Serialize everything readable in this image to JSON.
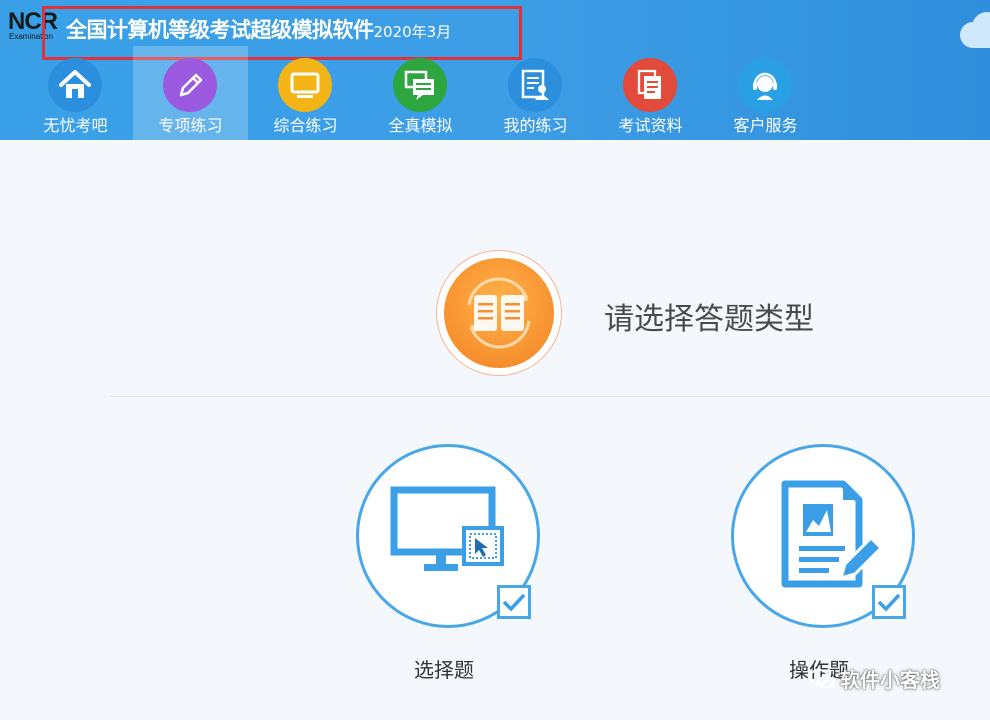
{
  "app": {
    "logo_text": "NCR",
    "logo_sub": "Examination",
    "title": "全国计算机等级考试超级模拟软件",
    "title_date": "2020年3月"
  },
  "nav": {
    "items": [
      {
        "label": "无忧考吧",
        "icon": "home-icon",
        "color": "#2b8fde"
      },
      {
        "label": "专项练习",
        "icon": "pencil-icon",
        "color": "#9b59e0",
        "active": true
      },
      {
        "label": "综合练习",
        "icon": "monitor-icon",
        "color": "#f3b417"
      },
      {
        "label": "全真模拟",
        "icon": "exam-screens-icon",
        "color": "#2ea640"
      },
      {
        "label": "我的练习",
        "icon": "user-document-icon",
        "color": "#2b8fde"
      },
      {
        "label": "考试资料",
        "icon": "documents-icon",
        "color": "#e24a3b"
      },
      {
        "label": "客户服务",
        "icon": "headset-icon",
        "color": "#29a0e3"
      }
    ]
  },
  "main": {
    "prompt": "请选择答题类型",
    "types": [
      {
        "label": "选择题",
        "icon": "computer-click-icon",
        "checked": true
      },
      {
        "label": "操作题",
        "icon": "document-edit-icon",
        "checked": true
      }
    ]
  },
  "watermark": {
    "text": "软件小客栈"
  },
  "colors": {
    "header": "#3d9ee6",
    "accent": "#49a7e8",
    "highlight_border": "#e0323a",
    "hero_orange": "#f7902f"
  }
}
